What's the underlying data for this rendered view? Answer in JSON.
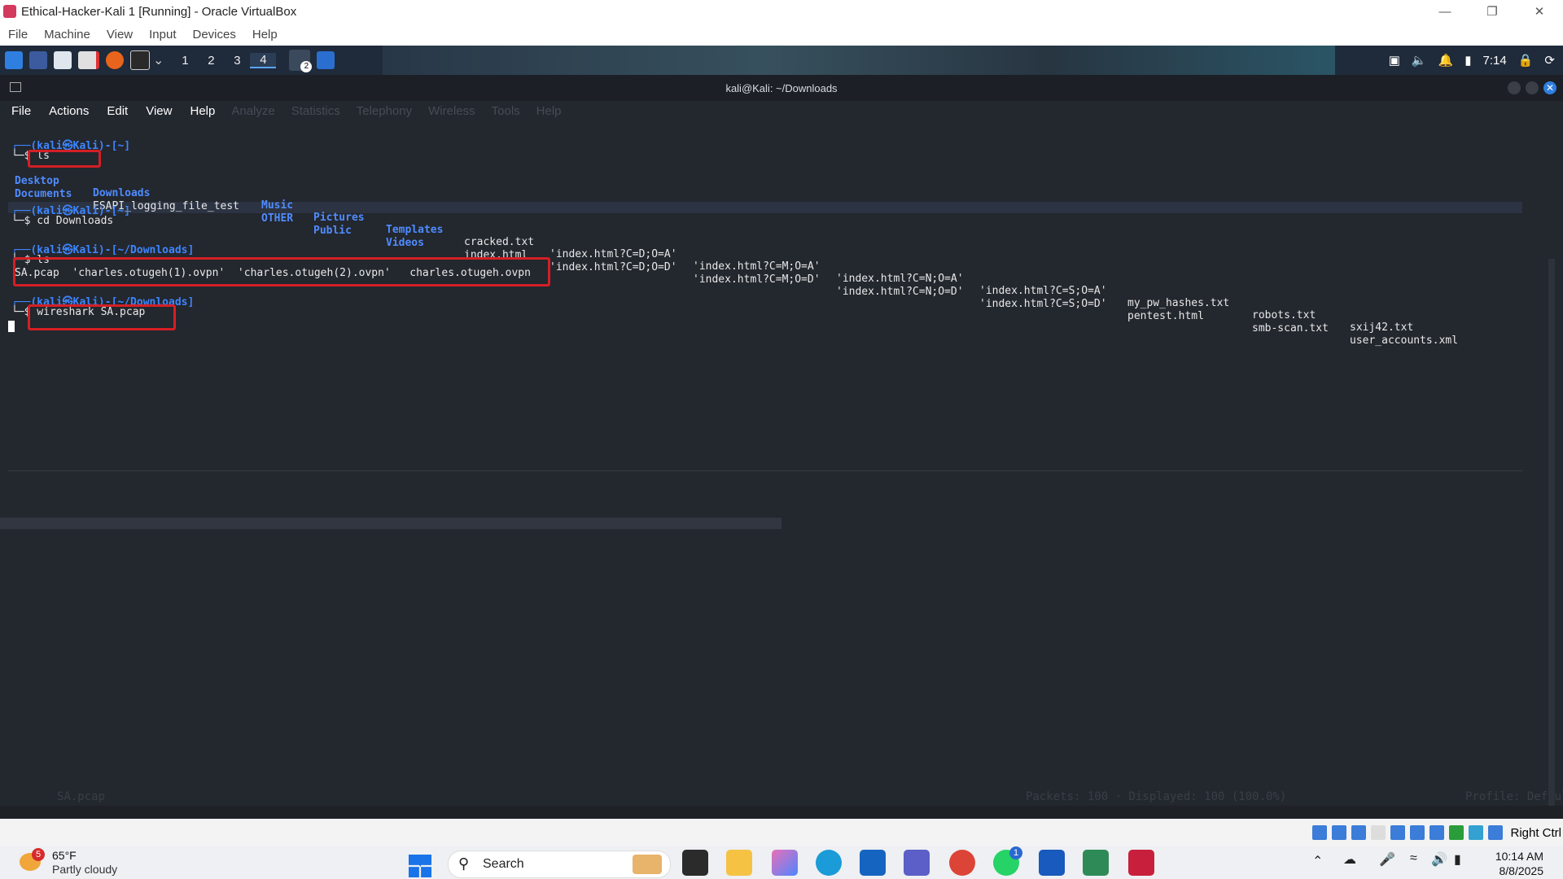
{
  "vbox": {
    "title": "Ethical-Hacker-Kali 1 [Running] - Oracle VirtualBox",
    "menu": [
      "File",
      "Machine",
      "View",
      "Input",
      "Devices",
      "Help"
    ],
    "host_key": "Right Ctrl"
  },
  "kali_panel": {
    "workspaces": [
      "1",
      "2",
      "3",
      "4"
    ],
    "active_workspace": "4",
    "badge": "2",
    "clock": "7:14"
  },
  "terminal": {
    "title": "kali@Kali: ~/Downloads",
    "menu": [
      "File",
      "Actions",
      "Edit",
      "View",
      "Help"
    ],
    "ghost_menu": [
      "Analyze",
      "Statistics",
      "Telephony",
      "Wireless",
      "Tools",
      "Help"
    ],
    "prompt1": "┌──(kali㉿Kali)-[~]",
    "cmd1": "└─$ ls",
    "ls_row1": {
      "dirs": [
        "Desktop",
        "Downloads",
        "Music",
        "Pictures",
        "Templates"
      ],
      "files": [
        "cracked.txt",
        "'index.html?C=D;O=A'",
        "'index.html?C=M;O=A'",
        "'index.html?C=N;O=A'",
        "'index.html?C=S;O=A'",
        "my_pw_hashes.txt",
        "robots.txt",
        "sxij42.txt"
      ]
    },
    "ls_row2": {
      "dirs": [
        "Documents",
        "OTHER",
        "Public",
        "Videos"
      ],
      "files": [
        "ESAPI_logging_file_test",
        "index.html",
        "'index.html?C=D;O=D'",
        "'index.html?C=M;O=D'",
        "'index.html?C=N;O=D'",
        "'index.html?C=S;O=D'",
        "pentest.html",
        "smb-scan.txt",
        "user_accounts.xml"
      ]
    },
    "prompt2": "┌──(kali㉿Kali)-[~]",
    "cmd2": "└─$ cd Downloads",
    "prompt3": "┌──(kali㉿Kali)-[~/Downloads]",
    "cmd3": "└─$ ls",
    "downloads_list": "SA.pcap  'charles.otugeh(1).ovpn'  'charles.otugeh(2).ovpn'   charles.otugeh.ovpn",
    "prompt4": "┌──(kali㉿Kali)-[~/Downloads]",
    "cmd4": "└─$ wireshark SA.pcap"
  },
  "wireshark_ghost": {
    "status_file": "SA.pcap",
    "status_packets": "Packets: 100 · Displayed: 100 (100.0%)",
    "profile": "Profile: Default"
  },
  "taskbar": {
    "weather_temp": "65°F",
    "weather_desc": "Partly cloudy",
    "weather_badge": "5",
    "search_label": "Search",
    "time": "10:14 AM",
    "date": "8/8/2025",
    "whatsapp_badge": "1"
  },
  "colors": {
    "terminal_bg": "#23272e",
    "prompt_blue": "#3d86ff",
    "highlight_red": "#d41f25"
  }
}
